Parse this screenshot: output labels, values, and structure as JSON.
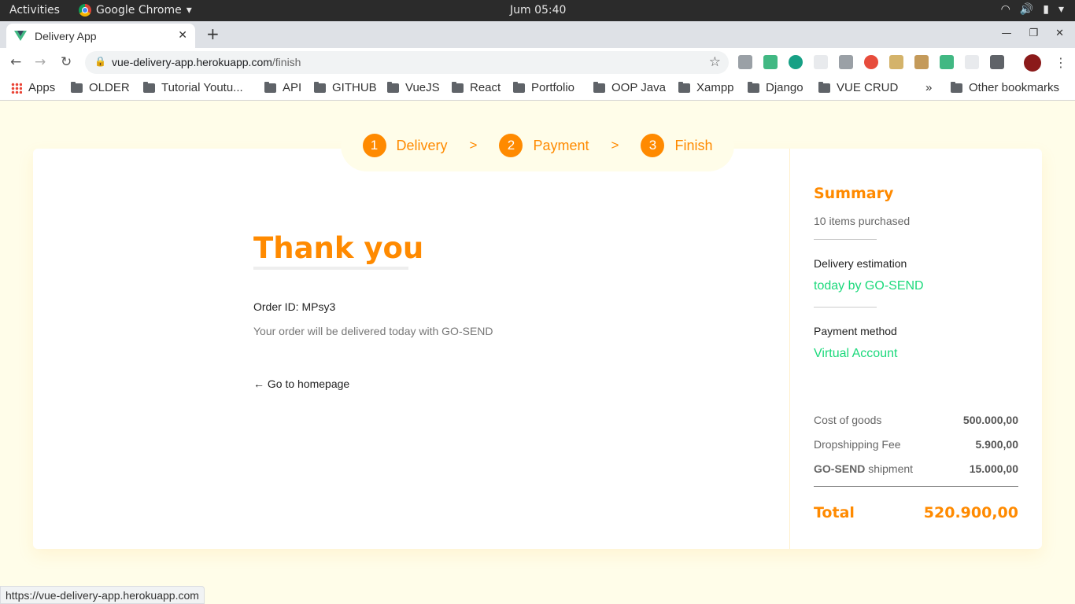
{
  "os_bar": {
    "activities": "Activities",
    "app_name": "Google Chrome",
    "clock": "Jum 05:40"
  },
  "browser": {
    "tab_title": "Delivery App",
    "url_host": "vue-delivery-app.herokuapp.com",
    "url_path": "/finish",
    "status_url": "https://vue-delivery-app.herokuapp.com"
  },
  "bookmarks": [
    "Apps",
    "OLDER",
    "Tutorial Youtu...",
    "API",
    "GITHUB",
    "VueJS",
    "React",
    "Portfolio",
    "OOP Java",
    "Xampp",
    "Django",
    "VUE CRUD"
  ],
  "bookmarks_overflow": "»",
  "other_bookmarks": "Other bookmarks",
  "stepper": {
    "steps": [
      {
        "num": "1",
        "label": "Delivery"
      },
      {
        "num": "2",
        "label": "Payment"
      },
      {
        "num": "3",
        "label": "Finish"
      }
    ],
    "separator": ">"
  },
  "finish": {
    "title": "Thank you",
    "order_id": "Order ID: MPsy3",
    "message": "Your order will be delivered today with GO-SEND",
    "home_link": "← Go to homepage"
  },
  "summary": {
    "title": "Summary",
    "items_purchased": "10 items purchased",
    "delivery_label": "Delivery estimation",
    "delivery_value": "today by GO-SEND",
    "payment_label": "Payment method",
    "payment_value": "Virtual Account",
    "cost_label": "Cost of goods",
    "cost_value": "500.000,00",
    "fee_label": "Dropshipping Fee",
    "fee_value": "5.900,00",
    "shipment_courier": "GO-SEND",
    "shipment_label": "shipment",
    "shipment_value": "15.000,00",
    "total_label": "Total",
    "total_value": "520.900,00"
  },
  "colors": {
    "accent": "#ff8a00",
    "success": "#1bd97b",
    "page_bg": "#fffde9"
  }
}
